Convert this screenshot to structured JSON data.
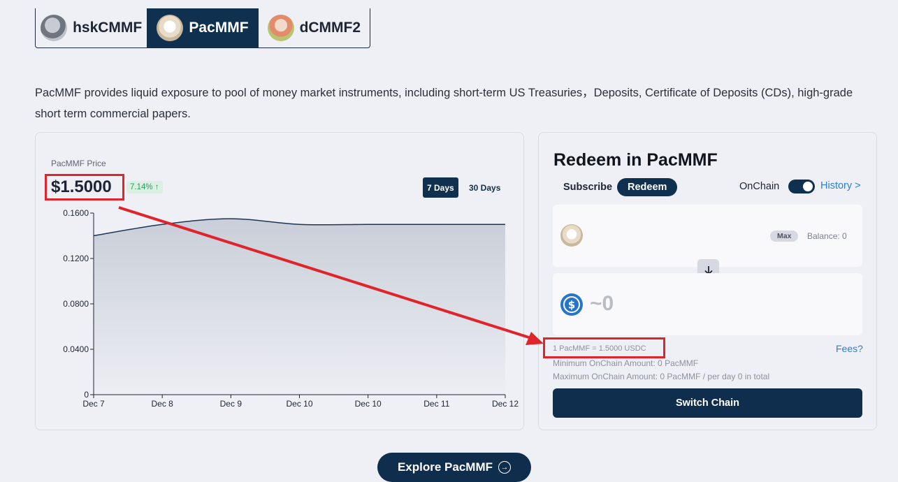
{
  "fund_tabs": [
    {
      "label": "hskCMMF",
      "active": false
    },
    {
      "label": "PacMMF",
      "active": true
    },
    {
      "label": "dCMMF2",
      "active": false
    }
  ],
  "description": "PacMMF provides liquid exposure to pool of money market instruments, including short-term US Treasuries，Deposits, Certificate of Deposits (CDs), high-grade short term commercial papers.",
  "price": {
    "label": "PacMMF Price",
    "value": "$1.5000",
    "change": "7.14% ↑",
    "range_7d": "7 Days",
    "range_30d": "30 Days",
    "active_range": "7 Days"
  },
  "chart_data": {
    "type": "area",
    "x": [
      "Dec 7",
      "Dec 8",
      "Dec 9",
      "Dec 10",
      "Dec 10",
      "Dec 11",
      "Dec 12"
    ],
    "series": [
      {
        "values": [
          0.14,
          0.15,
          0.155,
          0.15,
          0.15,
          0.15,
          0.15
        ]
      }
    ],
    "y_ticks": [
      "0.1600",
      "0.1200",
      "0.0800",
      "0.0400",
      "0"
    ],
    "ylim": [
      0,
      0.16
    ],
    "grid": false,
    "colors": {
      "line": "#1d3557",
      "fill_top": "#c9ced8",
      "fill_bottom": "#eceef3"
    }
  },
  "redeem": {
    "title": "Redeem in PacMMF",
    "subscribe_tab": "Subscribe",
    "redeem_tab": "Redeem",
    "onchain_label": "OnChain",
    "onchain_enabled": true,
    "history_link": "History >",
    "max_label": "Max",
    "balance": "Balance: 0",
    "output_amount": "~0",
    "rate": "1 PacMMF = 1.5000 USDC",
    "fees_link": "Fees?",
    "min_amount": "Minimum OnChain Amount: 0 PacMMF",
    "max_amount": "Maximum OnChain Amount: 0 PacMMF / per day 0 in total",
    "action_button": "Switch Chain"
  },
  "explore_button": "Explore PacMMF",
  "colors": {
    "brand": "#10304f",
    "link": "#2b7fd0",
    "annotation": "#e0242b",
    "positive": "#2b9d5c",
    "usdc": "#2775ca"
  }
}
